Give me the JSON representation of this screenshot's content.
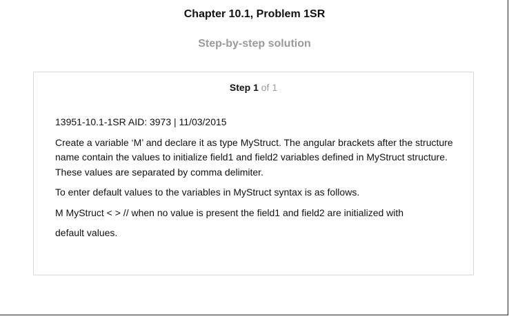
{
  "header": {
    "title": "Chapter 10.1, Problem 1SR",
    "subtitle": "Step-by-step solution"
  },
  "step": {
    "label": "Step 1",
    "of_text": "of 1",
    "paragraphs": [
      "13951-10.1-1SR AID: 3973 | 11/03/2015",
      "Create a variable ‘M’ and declare it as type MyStruct. The angular brackets after the structure name contain the values to initialize field1 and field2 variables defined in MyStruct structure. These values are separated by comma delimiter.",
      "To enter default values to the variables in MyStruct syntax is as follows.",
      "M MyStruct < > // when no value is present the field1 and field2 are initialized with",
      "default values."
    ]
  }
}
